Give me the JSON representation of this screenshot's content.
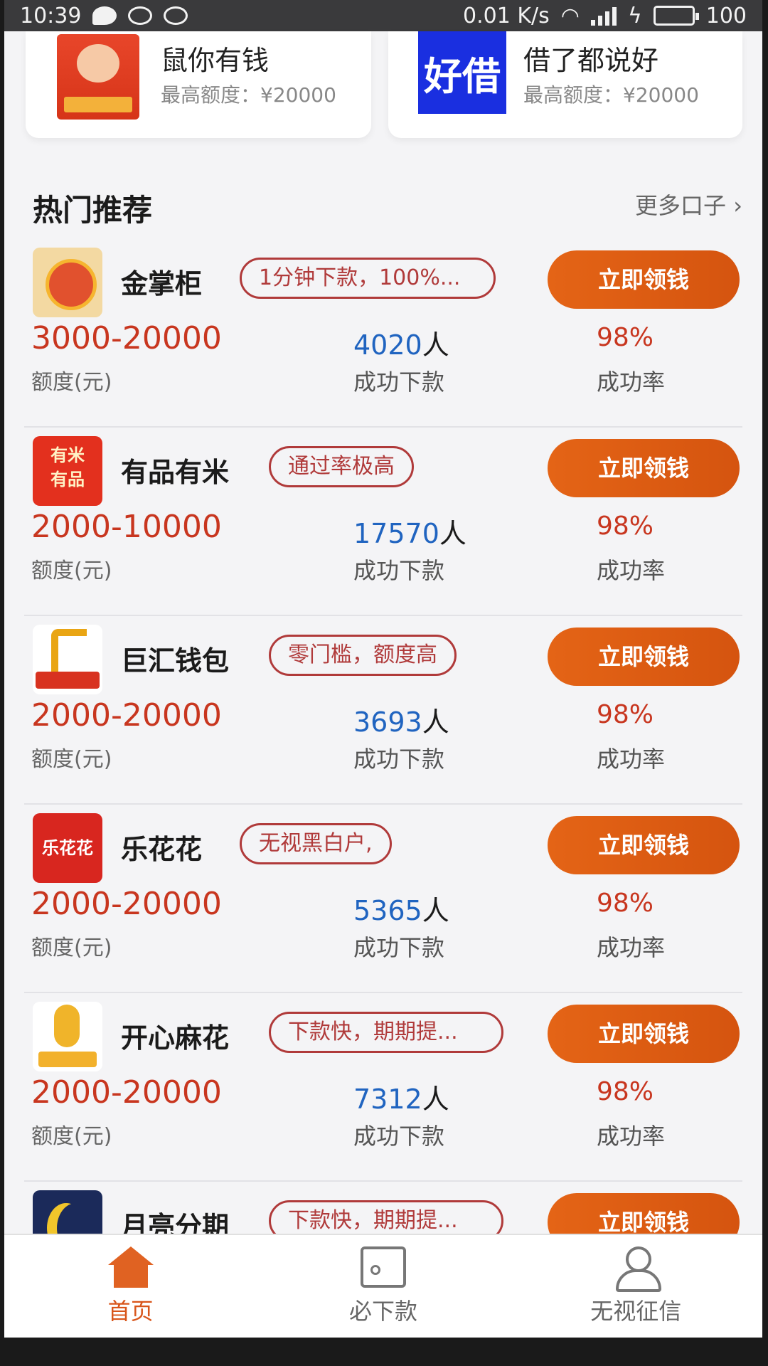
{
  "status_bar": {
    "time": "10:39",
    "network_speed": "0.01 K/s",
    "battery": "100"
  },
  "top_cards": [
    {
      "name": "鼠你有钱",
      "limit": "最高额度：¥20000",
      "logo_icon": "rat-logo-icon"
    },
    {
      "name": "借了都说好",
      "limit": "最高额度：¥20000",
      "logo_text": "好借"
    }
  ],
  "section": {
    "title": "热门推荐",
    "more": "更多口子 ›"
  },
  "products": [
    {
      "name": "金掌柜",
      "tag": "1分钟下款，100%...",
      "button": "立即领钱",
      "range": "3000-20000",
      "range_label": "额度(元)",
      "count": "4020",
      "unit": "人",
      "count_label": "成功下款",
      "rate": "98%",
      "rate_label": "成功率"
    },
    {
      "name": "有品有米",
      "tag": "通过率极高",
      "button": "立即领钱",
      "range": "2000-10000",
      "range_label": "额度(元)",
      "count": "17570",
      "unit": "人",
      "count_label": "成功下款",
      "rate": "98%",
      "rate_label": "成功率",
      "logo_text": "有米\n有品"
    },
    {
      "name": "巨汇钱包",
      "tag": "零门槛，额度高",
      "button": "立即领钱",
      "range": "2000-20000",
      "range_label": "额度(元)",
      "count": "3693",
      "unit": "人",
      "count_label": "成功下款",
      "rate": "98%",
      "rate_label": "成功率"
    },
    {
      "name": "乐花花",
      "tag": "无视黑白户,",
      "button": "立即领钱",
      "range": "2000-20000",
      "range_label": "额度(元)",
      "count": "5365",
      "unit": "人",
      "count_label": "成功下款",
      "rate": "98%",
      "rate_label": "成功率",
      "logo_text": "乐花花"
    },
    {
      "name": "开心麻花",
      "tag": "下款快，期期提...",
      "button": "立即领钱",
      "range": "2000-20000",
      "range_label": "额度(元)",
      "count": "7312",
      "unit": "人",
      "count_label": "成功下款",
      "rate": "98%",
      "rate_label": "成功率"
    },
    {
      "name": "月亮分期",
      "tag": "下款快，期期提...",
      "button": "立即领钱"
    }
  ],
  "tabs": [
    {
      "label": "首页",
      "icon": "home-icon",
      "active": true
    },
    {
      "label": "必下款",
      "icon": "wallet-icon",
      "active": false
    },
    {
      "label": "无视征信",
      "icon": "user-icon",
      "active": false
    }
  ],
  "colors": {
    "accent": "#e05f1b",
    "amount": "#c8361f",
    "count": "#2064c0",
    "tag_border": "#b03a3a"
  }
}
